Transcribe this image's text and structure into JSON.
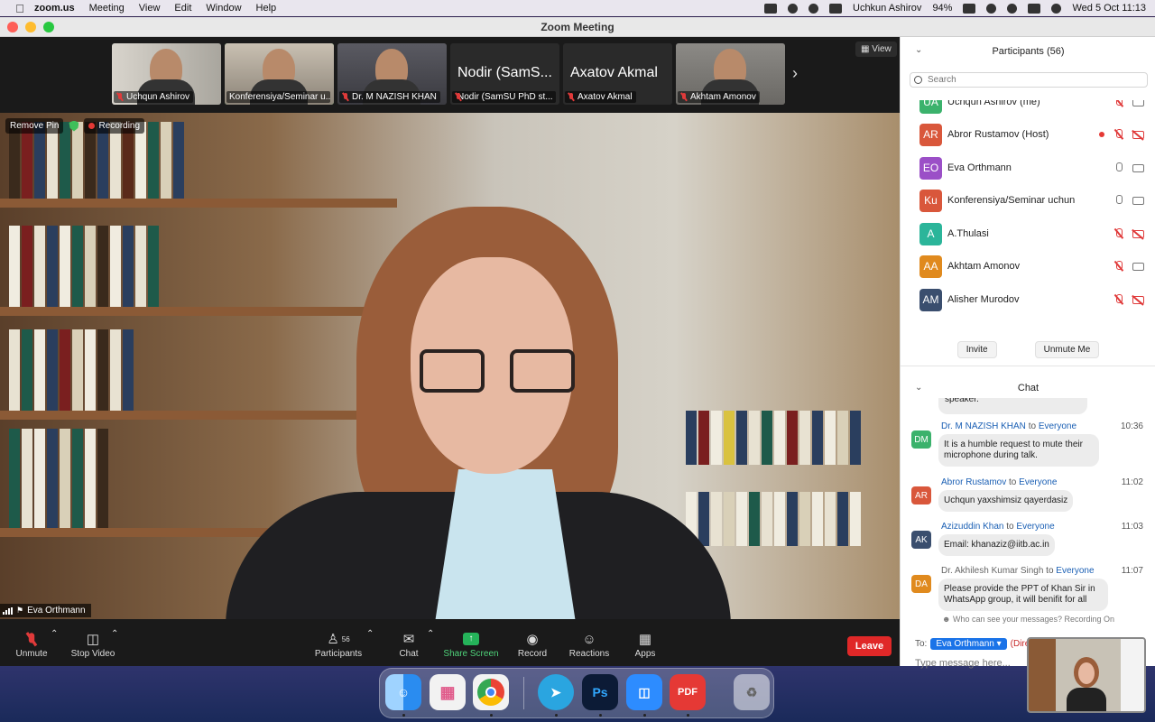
{
  "menubar": {
    "app": "zoom.us",
    "items": [
      "Meeting",
      "View",
      "Edit",
      "Window",
      "Help"
    ],
    "user": "Uchkun Ashirov",
    "battery": "94%",
    "datetime": "Wed 5 Oct  11:13"
  },
  "window": {
    "title": "Zoom Meeting"
  },
  "strip": {
    "thumbs": [
      {
        "label": "Uchqun Ashirov",
        "big": ""
      },
      {
        "label": "Konferensiya/Seminar u...",
        "big": ""
      },
      {
        "label": "Dr. M NAZISH KHAN",
        "big": ""
      },
      {
        "label": "Nodir (SamSU PhD st...",
        "big": "Nodir (SamS..."
      },
      {
        "label": "Axatov Akmal",
        "big": "Axatov Akmal"
      },
      {
        "label": "Akhtam Amonov",
        "big": ""
      }
    ],
    "view_label": "View"
  },
  "main_video": {
    "remove_pin": "Remove Pin",
    "recording": "Recording",
    "speaker": "Eva Orthmann"
  },
  "toolbar": {
    "unmute": "Unmute",
    "stop_video": "Stop Video",
    "participants": "Participants",
    "participants_count": "56",
    "chat": "Chat",
    "share": "Share Screen",
    "record": "Record",
    "reactions": "Reactions",
    "apps": "Apps",
    "leave": "Leave"
  },
  "participants_panel": {
    "title": "Participants (56)",
    "search_placeholder": "Search",
    "people": [
      {
        "initials": "UA",
        "name": "Uchqun Ashirov (me)",
        "color": "#3bb26c"
      },
      {
        "initials": "AR",
        "name": "Abror Rustamov (Host)",
        "color": "#d9573b"
      },
      {
        "initials": "EO",
        "name": "Eva Orthmann",
        "color": "#9b4fc7"
      },
      {
        "initials": "Ku",
        "name": "Konferensiya/Seminar uchun",
        "color": "#d9573b"
      },
      {
        "initials": "A",
        "name": "A.Thulasi",
        "color": "#2bb59a"
      },
      {
        "initials": "AA",
        "name": "Akhtam Amonov",
        "color": "#e08a1e"
      },
      {
        "initials": "AM",
        "name": "Alisher Murodov",
        "color": "#3a4e6e"
      }
    ],
    "invite": "Invite",
    "unmute_me": "Unmute Me"
  },
  "chat": {
    "title": "Chat",
    "prev_fragment": "speaker.",
    "messages": [
      {
        "initials": "DM",
        "color": "#3bb26c",
        "from": "Dr. M NAZISH KHAN",
        "to": "Everyone",
        "time": "10:36",
        "line1": "It is a humble request to mute their",
        "line2": "microphone during talk."
      },
      {
        "initials": "AR",
        "color": "#d9573b",
        "from": "Abror Rustamov",
        "to": "Everyone",
        "time": "11:02",
        "line1": "Uchqun yaxshimsiz qayerdasiz",
        "line2": ""
      },
      {
        "initials": "AK",
        "color": "#3a4e6e",
        "from": "Azizuddin Khan",
        "to": "Everyone",
        "time": "11:03",
        "line1": "Email:  khanaziz@iitb.ac.in",
        "line2": ""
      },
      {
        "initials": "DA",
        "color": "#e08a1e",
        "from": "Dr. Akhilesh Kumar Singh",
        "to": "Everyone",
        "time": "11:07",
        "line1": "Please provide the PPT of Khan Sir in",
        "line2": "WhatsApp group, it will benifit for all"
      }
    ],
    "to_word": "to",
    "who_can_see": "Who can see your messages? Recording On",
    "to_label": "To:",
    "recipient": "Eva Orthmann",
    "direct": "(Direct Message)",
    "input_placeholder": "Type message here..."
  },
  "dock": {
    "apps": [
      "Finder",
      "Launchpad",
      "Chrome",
      "Telegram",
      "Photoshop",
      "Zoom",
      "PDF",
      "Trash"
    ]
  }
}
